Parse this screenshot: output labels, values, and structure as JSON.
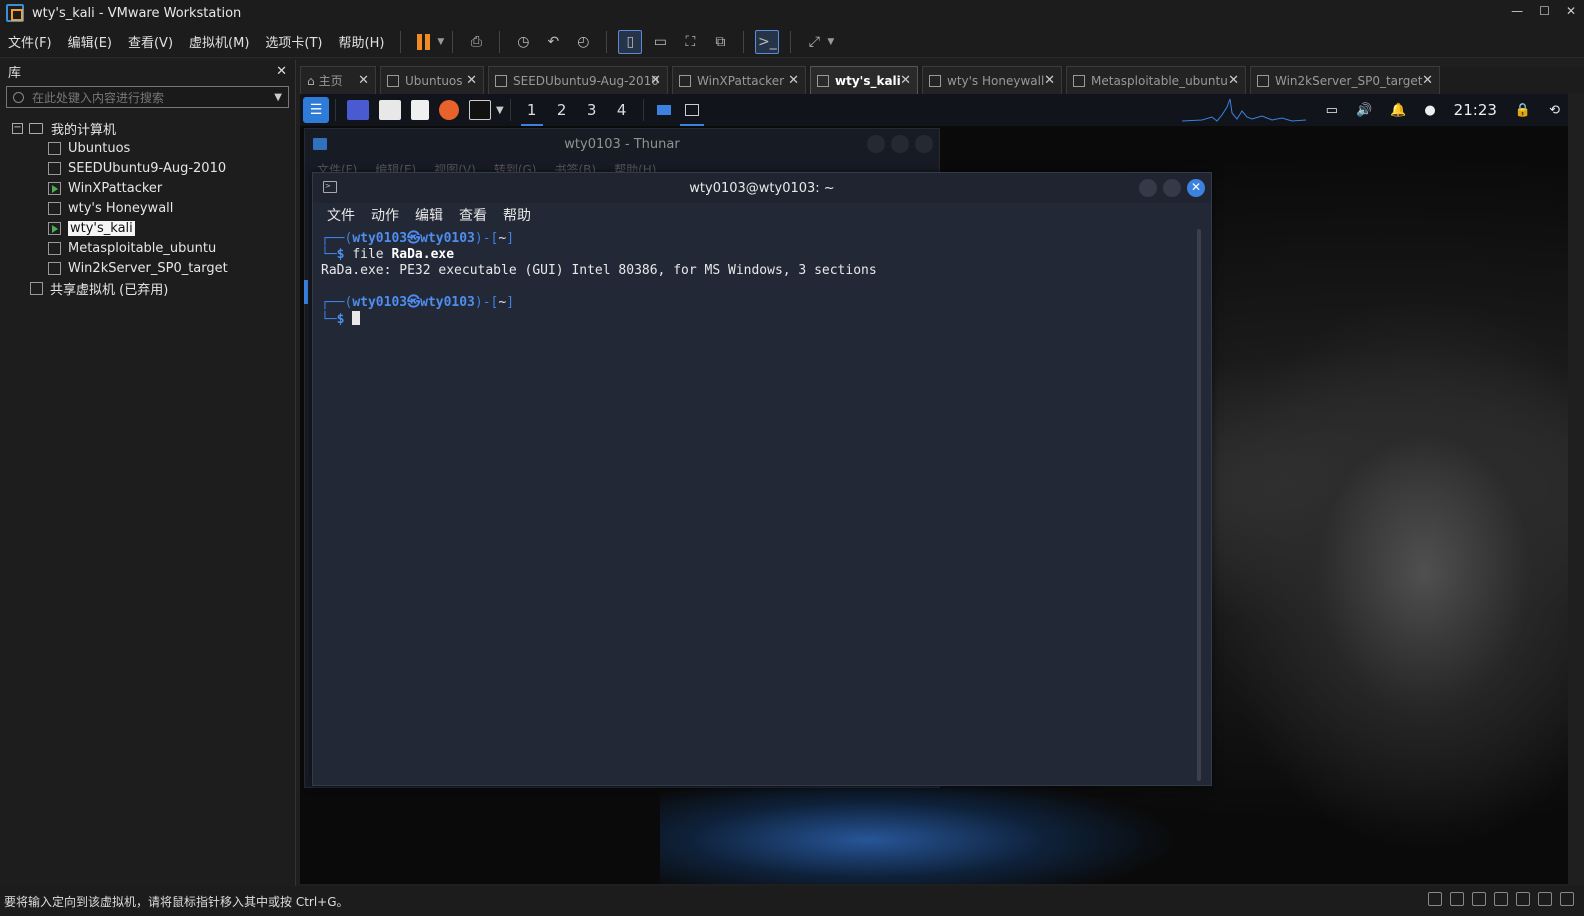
{
  "window": {
    "title": "wty's_kali - VMware Workstation"
  },
  "menu": [
    "文件(F)",
    "编辑(E)",
    "查看(V)",
    "虚拟机(M)",
    "选项卡(T)",
    "帮助(H)"
  ],
  "library": {
    "title": "库",
    "search_placeholder": "在此处键入内容进行搜索",
    "root": "我的计算机",
    "vms": [
      {
        "name": "Ubuntuos",
        "running": false
      },
      {
        "name": "SEEDUbuntu9-Aug-2010",
        "running": false
      },
      {
        "name": "WinXPattacker",
        "running": true
      },
      {
        "name": "wty's Honeywall",
        "running": false
      },
      {
        "name": "wty's_kali",
        "running": true,
        "selected": true
      },
      {
        "name": "Metasploitable_ubuntu",
        "running": false
      },
      {
        "name": "Win2kServer_SP0_target",
        "running": false
      }
    ],
    "shared": "共享虚拟机 (已弃用)"
  },
  "tabs": [
    {
      "label": "主页",
      "active": false
    },
    {
      "label": "Ubuntuos",
      "active": false
    },
    {
      "label": "SEEDUbuntu9-Aug-2010",
      "active": false
    },
    {
      "label": "WinXPattacker",
      "active": false
    },
    {
      "label": "wty's_kali",
      "active": true
    },
    {
      "label": "wty's Honeywall",
      "active": false
    },
    {
      "label": "Metasploitable_ubuntu",
      "active": false
    },
    {
      "label": "Win2kServer_SP0_target",
      "active": false
    }
  ],
  "kali_panel": {
    "workspaces": [
      "1",
      "2",
      "3",
      "4"
    ],
    "active_workspace": "1",
    "clock": "21:23"
  },
  "thunar": {
    "title": "wty0103 - Thunar",
    "menu": [
      "文件(F)",
      "编辑(E)",
      "视图(V)",
      "转到(G)",
      "书签(B)",
      "帮助(H)"
    ]
  },
  "terminal": {
    "title": "wty0103@wty0103: ~",
    "menu": [
      "文件",
      "动作",
      "编辑",
      "查看",
      "帮助"
    ],
    "prompt_user": "wty0103㉿wty0103",
    "prompt_dir": "~",
    "command1_prefix": "file ",
    "command1_arg": "RaDa.exe",
    "output1": "RaDa.exe: PE32 executable (GUI) Intel 80386, for MS Windows, 3 sections"
  },
  "statusbar": {
    "text": "要将输入定向到该虚拟机，请将鼠标指针移入其中或按 Ctrl+G。"
  }
}
